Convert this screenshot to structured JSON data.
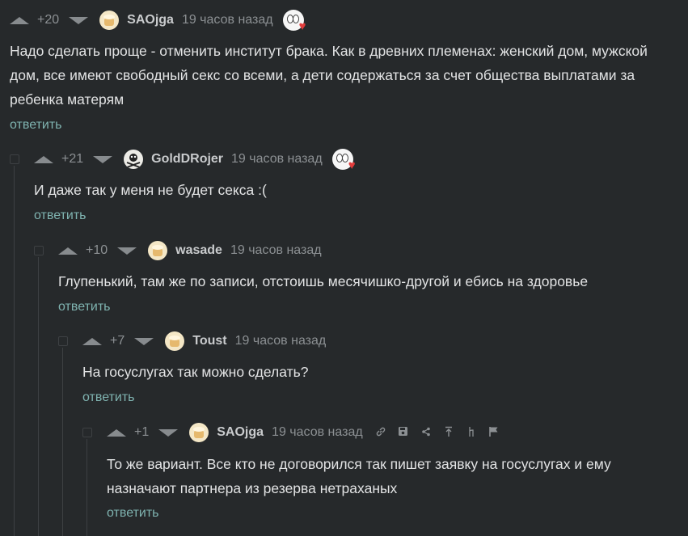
{
  "comments": [
    {
      "rating": "+20",
      "username": "SAOjga",
      "time": "19 часов назад",
      "text": "Надо сделать проще - отменить институт брака. Как в древних племенах: женский дом, мужской дом, все имеют свободный секс со всеми, а дети содержаться за счет общества выплатами за ребенка матерям",
      "reply": "ответить"
    },
    {
      "rating": "+21",
      "username": "GoldDRojer",
      "time": "19 часов назад",
      "text": "И даже так у меня не будет секса :(",
      "reply": "ответить"
    },
    {
      "rating": "+10",
      "username": "wasade",
      "time": "19 часов назад",
      "text": "Глупенький, там же по записи, отстоишь месячишко-другой и ебись на здоровье",
      "reply": "ответить"
    },
    {
      "rating": "+7",
      "username": "Toust",
      "time": "19 часов назад",
      "text": "На госуслугах так можно сделать?",
      "reply": "ответить"
    },
    {
      "rating": "+1",
      "username": "SAOjga",
      "time": "19 часов назад",
      "text": "То же вариант. Все кто не договорился так пишет заявку на госуслугах и ему назначают партнера из резерва нетраханых",
      "reply": "ответить"
    }
  ],
  "icons": {
    "link": "link-icon",
    "save": "save-icon",
    "share": "share-icon",
    "parent": "go-to-parent-icon",
    "branch": "branch-icon",
    "report": "flag-icon"
  },
  "colors": {
    "background": "#26292b",
    "text": "#e2e3e4",
    "meta": "#8c9093",
    "reply": "#7fb3b0"
  }
}
